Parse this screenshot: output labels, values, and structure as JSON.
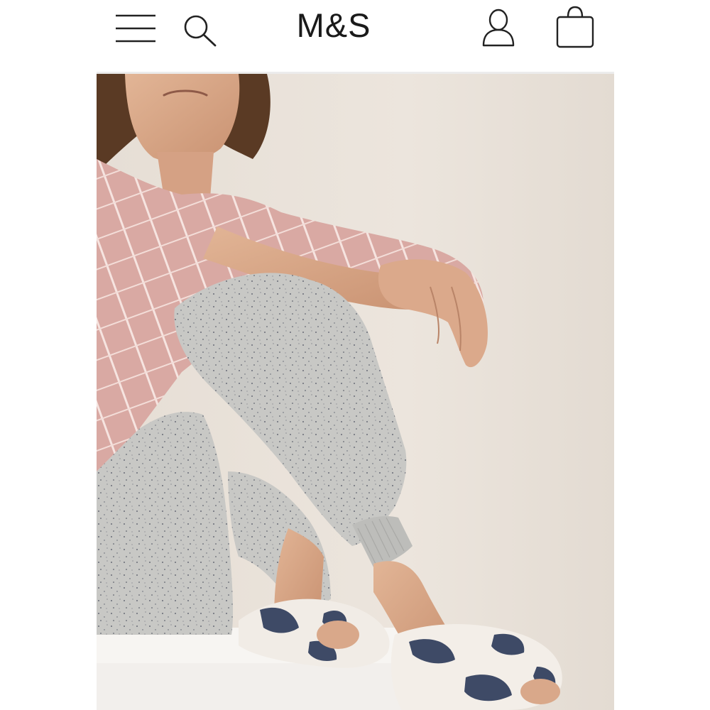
{
  "header": {
    "logo_text": "M&S",
    "icons": {
      "menu": "hamburger-menu-icon",
      "search": "search-icon",
      "account": "account-icon",
      "bag": "shopping-bag-icon"
    }
  },
  "hero": {
    "subject": "product-photo",
    "colors": {
      "background": "#e9e2da",
      "shirt": "#d9a9a3",
      "joggers": "#c9c9c6",
      "slipper": "#f1ece6",
      "star": "#3e4a66",
      "skin": "#d9a88a",
      "hair": "#5a3a24"
    }
  }
}
